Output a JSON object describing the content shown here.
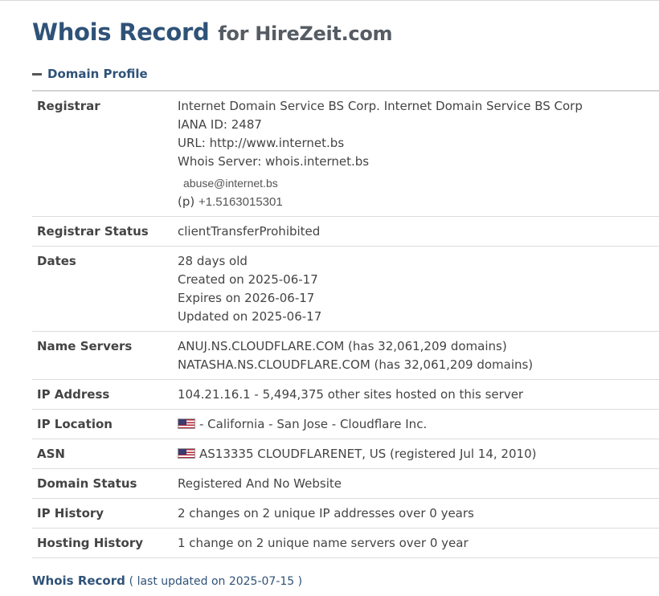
{
  "header": {
    "title_main": "Whois Record",
    "title_sub": "for HireZeit.com"
  },
  "section": {
    "label": "Domain Profile"
  },
  "registrar": {
    "label": "Registrar",
    "name": "Internet Domain Service BS Corp. Internet Domain Service BS Corp",
    "iana": "IANA ID: 2487",
    "url": "URL: http://www.internet.bs",
    "whois_server": "Whois Server: whois.internet.bs",
    "email": "abuse@internet.bs",
    "phone_prefix": "(p)",
    "phone": "+1.5163015301"
  },
  "registrar_status": {
    "label": "Registrar Status",
    "value": "clientTransferProhibited"
  },
  "dates": {
    "label": "Dates",
    "age": "28 days old",
    "created": "Created on 2025-06-17",
    "expires": "Expires on 2026-06-17",
    "updated": "Updated on 2025-06-17"
  },
  "name_servers": {
    "label": "Name Servers",
    "ns1": "ANUJ.NS.CLOUDFLARE.COM (has 32,061,209 domains)",
    "ns2": "NATASHA.NS.CLOUDFLARE.COM (has 32,061,209 domains)"
  },
  "ip_address": {
    "label": "IP Address",
    "value": "104.21.16.1 - 5,494,375 other sites hosted on this server"
  },
  "ip_location": {
    "label": "IP Location",
    "value": "- California - San Jose - Cloudflare Inc.",
    "flag_icon": "us-flag-icon"
  },
  "asn": {
    "label": "ASN",
    "value": "AS13335 CLOUDFLARENET, US (registered Jul 14, 2010)",
    "flag_icon": "us-flag-icon"
  },
  "domain_status": {
    "label": "Domain Status",
    "value": "Registered And No Website"
  },
  "ip_history": {
    "label": "IP History",
    "value": "2 changes on 2 unique IP addresses over 0 years"
  },
  "hosting_history": {
    "label": "Hosting History",
    "value": "1 change on 2 unique name servers over 0 year"
  },
  "footer": {
    "link": "Whois Record",
    "updated": "( last updated on 2025-07-15 )"
  },
  "colors": {
    "title": "#2f5278",
    "subtitle": "#555c63",
    "text": "#444444",
    "border": "#dcdcdc"
  }
}
